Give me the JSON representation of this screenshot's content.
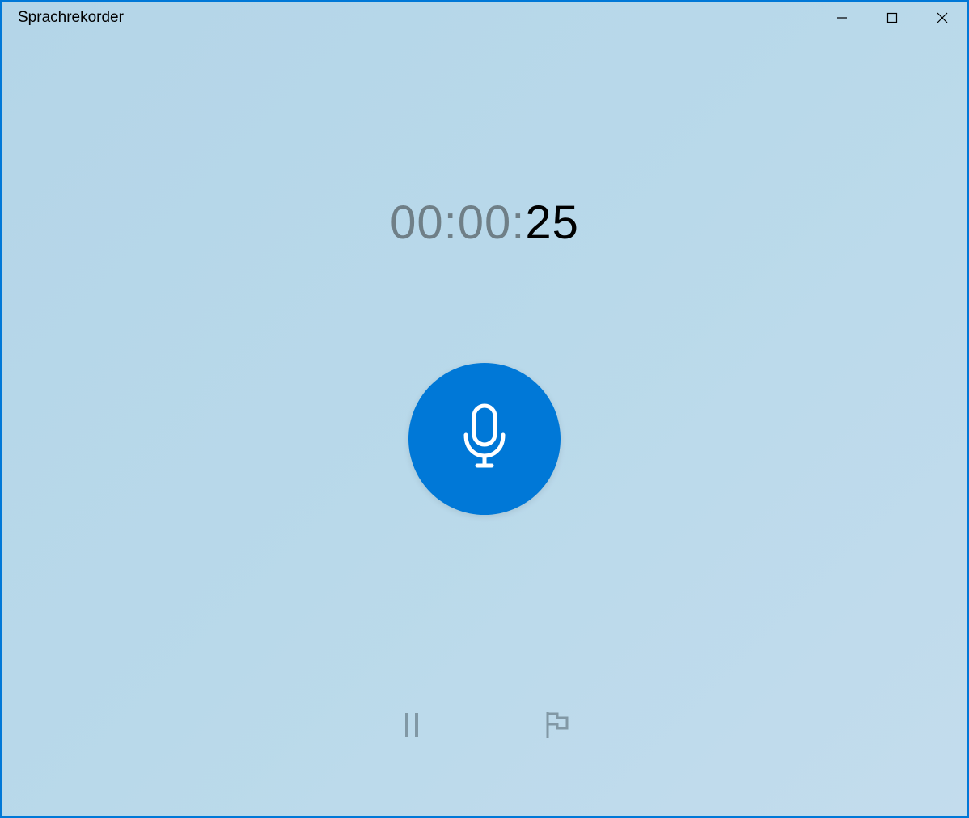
{
  "window": {
    "title": "Sprachrekorder"
  },
  "timer": {
    "hours": "00",
    "colon1": ":",
    "minutes": "00",
    "colon2": ":",
    "seconds": "25"
  },
  "icons": {
    "minimize": "minimize",
    "maximize": "maximize",
    "close": "close",
    "microphone": "microphone",
    "pause": "pause",
    "flag": "flag"
  },
  "colors": {
    "accent": "#0078d7",
    "background": "#b4d5e8"
  }
}
